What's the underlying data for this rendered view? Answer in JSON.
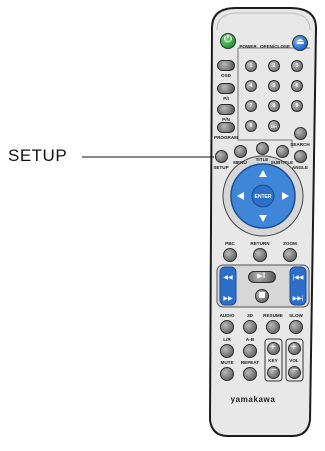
{
  "callout": {
    "label": "SETUP"
  },
  "top": {
    "power": "POWER",
    "open_close": "OPEN/CLOSE"
  },
  "left_column": {
    "osd": "OSD",
    "pi": "P/I",
    "pn": "P/N",
    "program": "PROGRAM"
  },
  "numpad": [
    "1",
    "2",
    "3",
    "4",
    "5",
    "6",
    "7",
    "8",
    "9",
    "0",
    "10+"
  ],
  "mid_labels": {
    "search": "SEARCH",
    "setup": "SETUP",
    "menu": "MENU",
    "title": "TITLE",
    "subtitle": "SUBTITLE",
    "angle": "ANGLE"
  },
  "nav": {
    "enter": "ENTER"
  },
  "row_pbc": {
    "pbc": "PBC",
    "return": "RETURN",
    "zoom": "ZOOM"
  },
  "row_audio": {
    "audio": "AUDIO",
    "3d": "3D",
    "resume": "RESUME",
    "slow": "SLOW"
  },
  "row_lr": {
    "lr": "L/R",
    "ab": "A-B"
  },
  "row_mute": {
    "mute": "MUTE",
    "repeat": "REPEAT",
    "key": "KEY",
    "vol": "VOL"
  },
  "brand": "yamakawa",
  "colors": {
    "power": "#2f9e3a",
    "eject": "#1f6fd1",
    "nav_blue": "#3f86d8",
    "panel_blue": "#2d6fc8"
  }
}
